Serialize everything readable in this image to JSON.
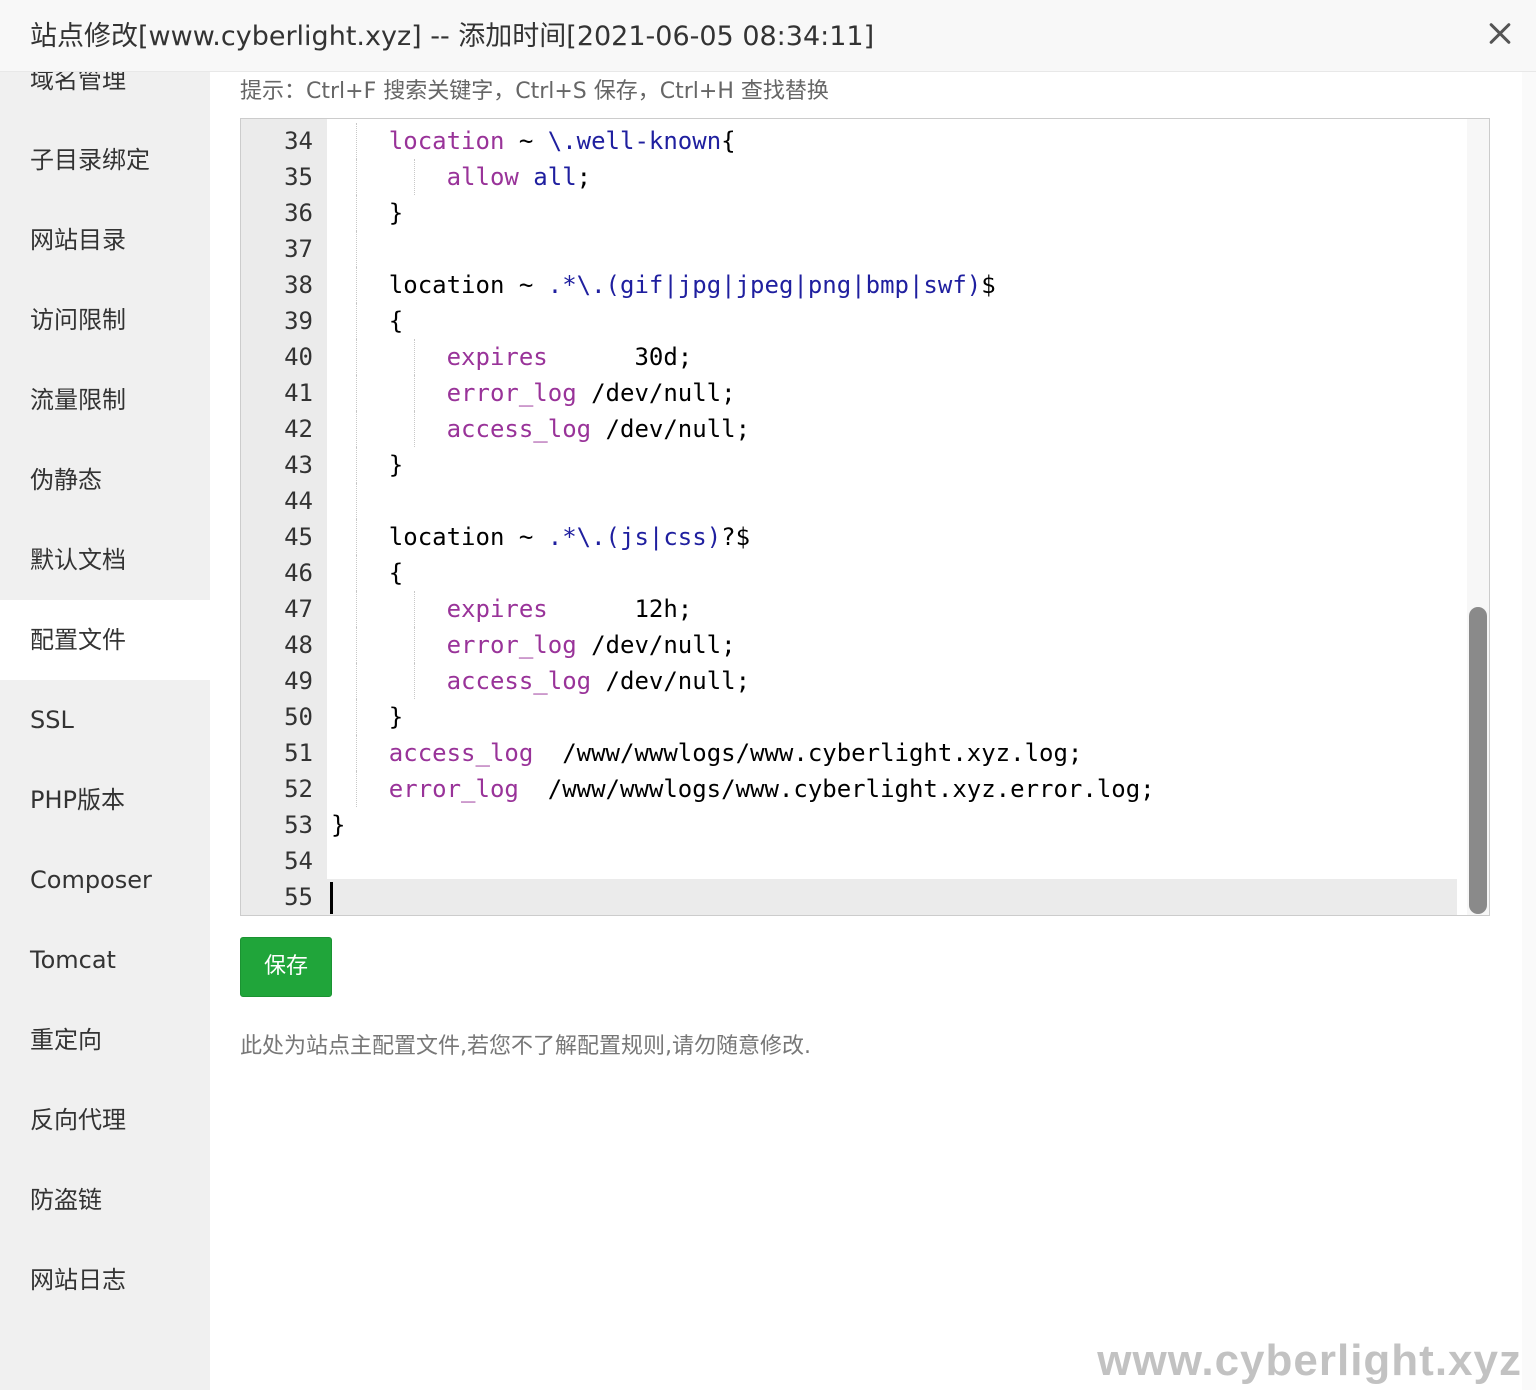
{
  "window": {
    "title": "站点修改[www.cyberlight.xyz] -- 添加时间[2021-06-05 08:34:11]",
    "close_icon": "close-icon"
  },
  "sidebar": {
    "items": [
      {
        "label": "域名管理"
      },
      {
        "label": "子目录绑定"
      },
      {
        "label": "网站目录"
      },
      {
        "label": "访问限制"
      },
      {
        "label": "流量限制"
      },
      {
        "label": "伪静态"
      },
      {
        "label": "默认文档"
      },
      {
        "label": "配置文件",
        "active": true
      },
      {
        "label": "SSL"
      },
      {
        "label": "PHP版本"
      },
      {
        "label": "Composer"
      },
      {
        "label": "Tomcat"
      },
      {
        "label": "重定向"
      },
      {
        "label": "反向代理"
      },
      {
        "label": "防盗链"
      },
      {
        "label": "网站日志"
      }
    ]
  },
  "main": {
    "hint": "提示：Ctrl+F 搜索关键字，Ctrl+S 保存，Ctrl+H 查找替换",
    "save_label": "保存",
    "note": "此处为站点主配置文件,若您不了解配置规则,请勿随意修改."
  },
  "editor": {
    "current_line": 55,
    "lines": [
      {
        "n": "34",
        "indent": 1,
        "tokens": [
          {
            "t": "location",
            "c": "kw"
          },
          {
            "t": " ~ "
          },
          {
            "t": "\\.well-known",
            "c": "rx"
          },
          {
            "t": "{"
          }
        ]
      },
      {
        "n": "35",
        "indent": 2,
        "tokens": [
          {
            "t": "allow",
            "c": "kw"
          },
          {
            "t": " "
          },
          {
            "t": "all",
            "c": "rx"
          },
          {
            "t": ";"
          }
        ]
      },
      {
        "n": "36",
        "indent": 1,
        "tokens": [
          {
            "t": "}"
          }
        ]
      },
      {
        "n": "37",
        "indent": 1,
        "tokens": []
      },
      {
        "n": "38",
        "indent": 1,
        "tokens": [
          {
            "t": "location ~ "
          },
          {
            "t": ".*\\.(gif|jpg|jpeg|png|bmp|swf)",
            "c": "rx"
          },
          {
            "t": "$"
          }
        ]
      },
      {
        "n": "39",
        "indent": 1,
        "tokens": [
          {
            "t": "{"
          }
        ]
      },
      {
        "n": "40",
        "indent": 2,
        "tokens": [
          {
            "t": "expires",
            "c": "kw"
          },
          {
            "t": "      30d;"
          }
        ]
      },
      {
        "n": "41",
        "indent": 2,
        "tokens": [
          {
            "t": "error_log",
            "c": "kw"
          },
          {
            "t": " /dev/null;"
          }
        ]
      },
      {
        "n": "42",
        "indent": 2,
        "tokens": [
          {
            "t": "access_log",
            "c": "kw"
          },
          {
            "t": " /dev/null;"
          }
        ]
      },
      {
        "n": "43",
        "indent": 1,
        "tokens": [
          {
            "t": "}"
          }
        ]
      },
      {
        "n": "44",
        "indent": 1,
        "tokens": []
      },
      {
        "n": "45",
        "indent": 1,
        "tokens": [
          {
            "t": "location ~ "
          },
          {
            "t": ".*\\.(js|css)",
            "c": "rx"
          },
          {
            "t": "?$"
          }
        ]
      },
      {
        "n": "46",
        "indent": 1,
        "tokens": [
          {
            "t": "{"
          }
        ]
      },
      {
        "n": "47",
        "indent": 2,
        "tokens": [
          {
            "t": "expires",
            "c": "kw"
          },
          {
            "t": "      12h;"
          }
        ]
      },
      {
        "n": "48",
        "indent": 2,
        "tokens": [
          {
            "t": "error_log",
            "c": "kw"
          },
          {
            "t": " /dev/null;"
          }
        ]
      },
      {
        "n": "49",
        "indent": 2,
        "tokens": [
          {
            "t": "access_log",
            "c": "kw"
          },
          {
            "t": " /dev/null;"
          }
        ]
      },
      {
        "n": "50",
        "indent": 1,
        "tokens": [
          {
            "t": "}"
          }
        ]
      },
      {
        "n": "51",
        "indent": 1,
        "tokens": [
          {
            "t": "access_log",
            "c": "kw"
          },
          {
            "t": "  /www/wwwlogs/www.cyberlight.xyz.log;"
          }
        ]
      },
      {
        "n": "52",
        "indent": 1,
        "tokens": [
          {
            "t": "error_log",
            "c": "kw"
          },
          {
            "t": "  /www/wwwlogs/www.cyberlight.xyz.error.log;"
          }
        ]
      },
      {
        "n": "53",
        "indent": 0,
        "tokens": [
          {
            "t": "}"
          }
        ]
      },
      {
        "n": "54",
        "indent": 0,
        "tokens": []
      },
      {
        "n": "55",
        "indent": 0,
        "tokens": []
      }
    ]
  },
  "watermark": "www.cyberlight.xyz",
  "colors": {
    "keyword": "#993399",
    "regex": "#1f1f9f",
    "save_button": "#20a53a"
  }
}
